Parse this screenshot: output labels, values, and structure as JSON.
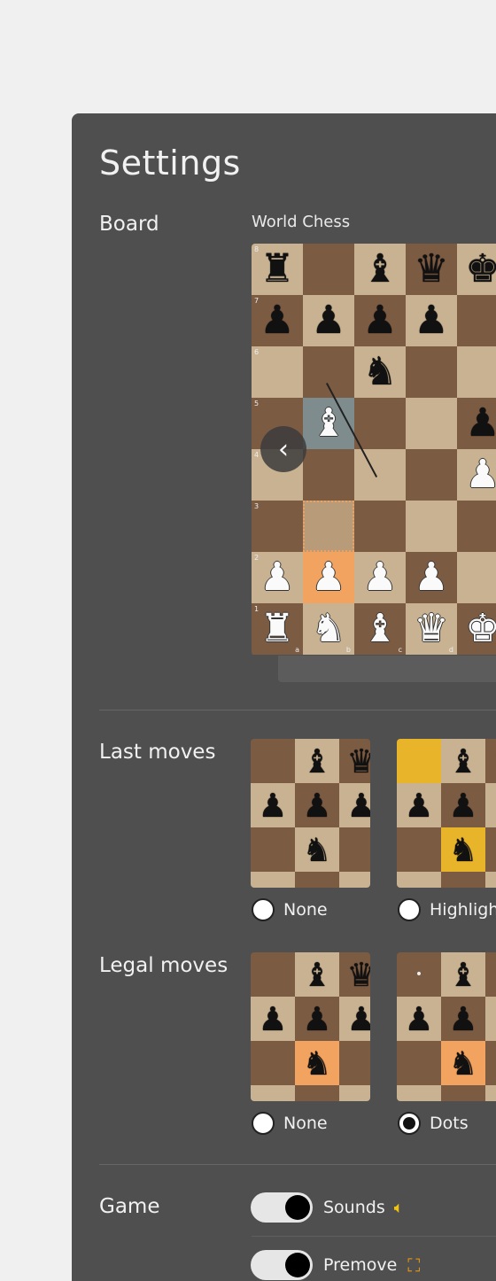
{
  "settings": {
    "title": "Settings",
    "board_label": "Board",
    "board_name": "World Chess",
    "last_moves_label": "Last moves",
    "legal_moves_label": "Legal moves",
    "game_label": "Game"
  },
  "board": {
    "ranks": [
      "8",
      "7",
      "6",
      "5",
      "4",
      "3",
      "2",
      "1"
    ],
    "files": [
      "a",
      "b",
      "c",
      "d"
    ],
    "prev_icon": "chevron-left-icon"
  },
  "last_moves": {
    "options": [
      {
        "label": "None",
        "selected": false
      },
      {
        "label": "Highlight",
        "selected": false
      }
    ]
  },
  "legal_moves": {
    "options": [
      {
        "label": "None",
        "selected": false
      },
      {
        "label": "Dots",
        "selected": true
      }
    ]
  },
  "game": {
    "toggles": [
      {
        "label": "Sounds",
        "on": true,
        "icon": "speaker-icon"
      },
      {
        "label": "Premove",
        "on": true,
        "icon": "premove-frame-icon"
      }
    ]
  },
  "colors": {
    "panel": "#4f4f4f",
    "board_light": "#c9b291",
    "board_dark": "#7c5b43",
    "highlight_orange": "#f2a35f",
    "highlight_yellow": "#e8b52a"
  }
}
